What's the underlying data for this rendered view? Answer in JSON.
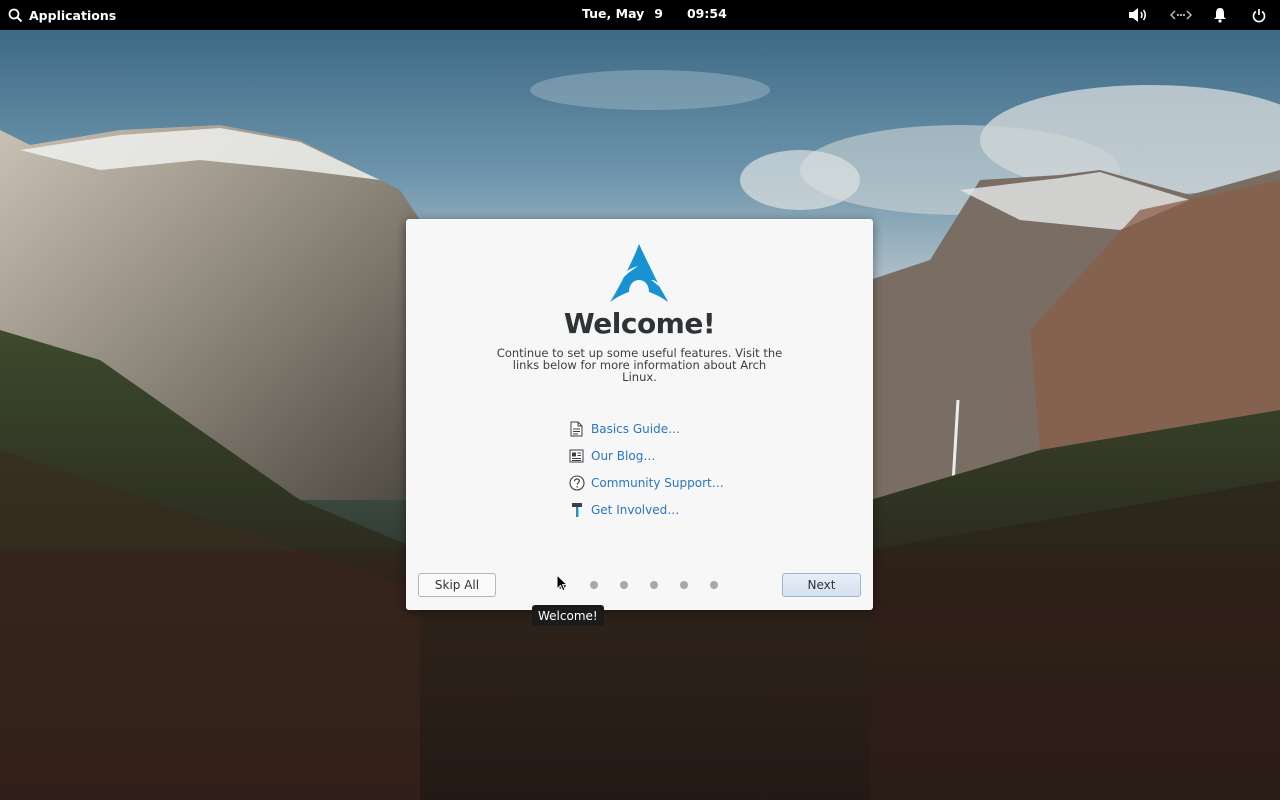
{
  "topbar": {
    "activities_label": "Applications",
    "date": "Tue, May",
    "day": "9",
    "time": "09:54",
    "tray": [
      "volume-icon",
      "network-icon",
      "notifications-icon",
      "power-icon"
    ]
  },
  "dialog": {
    "title": "Welcome!",
    "description": "Continue to set up some useful features. Visit the links below for more information about Arch Linux.",
    "links": [
      {
        "label": "Basics Guide…",
        "icon": "document-icon"
      },
      {
        "label": "Our Blog…",
        "icon": "newspaper-icon"
      },
      {
        "label": "Community Support…",
        "icon": "help-icon"
      },
      {
        "label": "Get Involved…",
        "icon": "hammer-icon"
      }
    ],
    "skip_label": "Skip All",
    "next_label": "Next",
    "page_count": 6,
    "current_page": 1
  },
  "tooltip": {
    "text": "Welcome!"
  },
  "colors": {
    "accent": "#1793d1",
    "link": "#2a76c6",
    "topbar": "#000000"
  }
}
